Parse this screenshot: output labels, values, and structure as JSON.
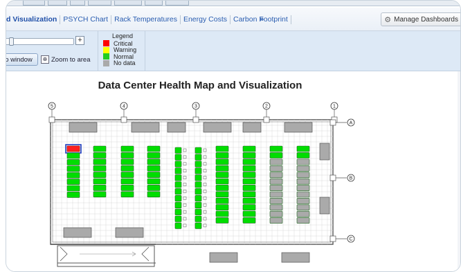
{
  "tabs": [
    {
      "label": "d Visualization",
      "active": true
    },
    {
      "label": "PSYCH Chart",
      "active": false
    },
    {
      "label": "Rack Temperatures",
      "active": false
    },
    {
      "label": "Energy Costs",
      "active": false
    },
    {
      "label": "Carbon Footprint",
      "active": false
    }
  ],
  "more_tabs": "»",
  "manage_label": "Manage Dashboards",
  "toolbar": {
    "zoom_in": "+",
    "fit_label": "o window",
    "zoom_area_label": "Zoom to area"
  },
  "legend": {
    "title": "Legend",
    "items": [
      {
        "label": "Critical",
        "color": "#ff0000"
      },
      {
        "label": "Warning",
        "color": "#ffff00"
      },
      {
        "label": "Normal",
        "color": "#22cc22"
      },
      {
        "label": "No data",
        "color": "#aaaaaa"
      }
    ]
  },
  "page_title": "Data Center Health Map and Visualization",
  "map": {
    "column_markers": [
      "5",
      "4",
      "3",
      "2",
      "1"
    ],
    "row_markers": [
      "A",
      "B",
      "C"
    ],
    "status_colors": {
      "normal": "#00dd00",
      "critical": "#ff2020",
      "nodata": "#aaaaaa"
    }
  }
}
